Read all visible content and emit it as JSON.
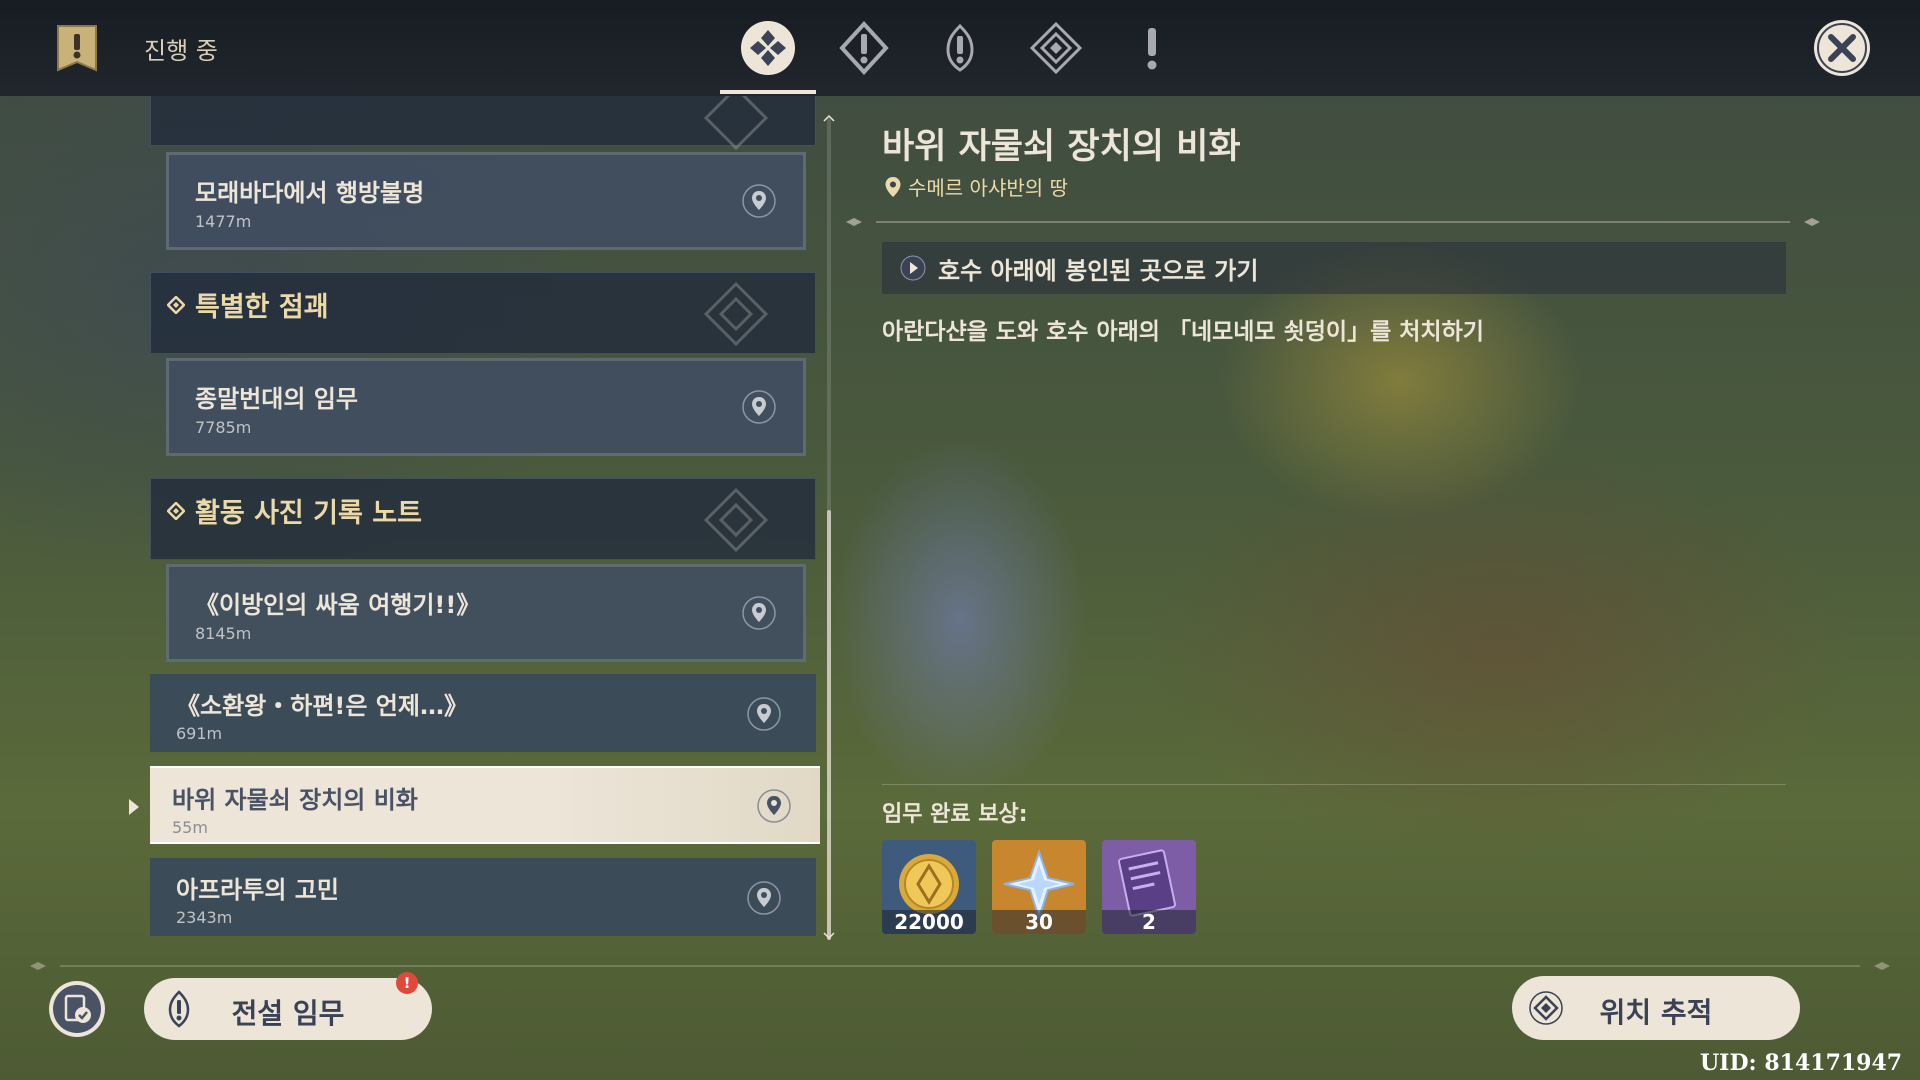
{
  "header": {
    "title": "진행 중",
    "tabs": [
      {
        "icon": "all-quests-icon",
        "active": true
      },
      {
        "icon": "archon-quest-icon",
        "active": false
      },
      {
        "icon": "story-quest-icon",
        "active": false
      },
      {
        "icon": "world-quest-icon",
        "active": false
      },
      {
        "icon": "commission-quest-icon",
        "active": false
      }
    ]
  },
  "quest_list": {
    "cut_group": "",
    "items": [
      {
        "name": "모래바다에서 행방불명",
        "distance": "1477m"
      },
      {
        "group": "특별한 점괘"
      },
      {
        "name": "종말번대의 임무",
        "distance": "7785m"
      },
      {
        "group": "활동 사진 기록 노트"
      },
      {
        "name": "《이방인의 싸움 여행기!!》",
        "distance": "8145m"
      },
      {
        "name": "《소환왕・하편!은 언제…》",
        "distance": "691m"
      },
      {
        "name": "바위 자물쇠 장치의 비화",
        "distance": "55m",
        "selected": true
      },
      {
        "name": "아프라투의 고민",
        "distance": "2343m"
      }
    ]
  },
  "detail": {
    "title": "바위 자물쇠 장치의 비화",
    "location": "수메르 아샤반의 땅",
    "objective": "호수 아래에 봉인된 곳으로 가기",
    "description": "아란다샨을 도와 호수 아래의 「네모네모 쇳덩이」를 처치하기",
    "reward_label": "임무 완료 보상:",
    "rewards": [
      {
        "icon": "mora-icon",
        "count": "22000",
        "bg": "#3e5a7c"
      },
      {
        "icon": "primogem-icon",
        "count": "30",
        "bg": "#c8872e"
      },
      {
        "icon": "heros-wit-book-icon",
        "count": "2",
        "bg": "#7d5ea6"
      }
    ]
  },
  "footer": {
    "legend_button": "전설 임무",
    "legend_badge": "!",
    "track_button": "위치 추적",
    "uid": "UID: 814171947"
  },
  "colors": {
    "accent": "#ece5d8",
    "gold": "#ecd9a8",
    "badge": "#e0483c"
  }
}
